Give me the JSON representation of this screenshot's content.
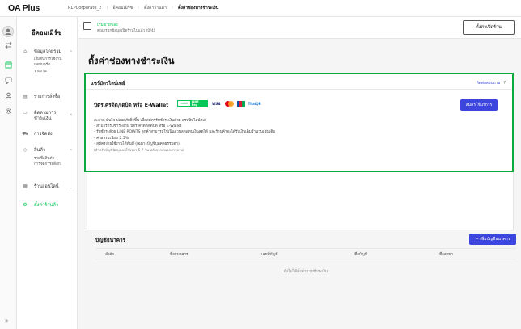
{
  "app": {
    "logo": "OA Plus"
  },
  "breadcrumb": [
    "RLPCorporate_2",
    "อีคอมเมิร์ซ",
    "ตั้งค่าร้านค้า",
    "ตั้งค่าช่องทางชำระเงิน"
  ],
  "sidebar": {
    "shop_name": "อีคอมเมิร์ซ",
    "items": [
      {
        "label": "ข้อมูลโดยรวม",
        "icon": "home-icon",
        "subitems": [
          "เริ่มต้นการใช้งาน",
          "แดชบอร์ด",
          "รายงาน"
        ]
      },
      {
        "label": "รายการสั่งซื้อ",
        "icon": "order-icon"
      },
      {
        "label": "ติดตามการชำระเงิน",
        "icon": "payment-icon"
      },
      {
        "label": "การจัดส่ง",
        "icon": "truck-icon"
      },
      {
        "label": "สินค้า",
        "icon": "tag-icon",
        "subitems": [
          "รายชื่อสินค้า",
          "การจัดการสต็อก"
        ]
      },
      {
        "label": "ร้านออนไลน์",
        "icon": "store-icon"
      },
      {
        "label": "ตั้งค่าร้านค้า",
        "icon": "settings-icon"
      }
    ]
  },
  "banner": {
    "title": "เริ่มขายของ",
    "subtitle": "คุณกรอกข้อมูลเปิดร้านไปแล้ว (0/4)",
    "button": "ตั้งค่าเปิดร้าน"
  },
  "page_title": "ตั้งค่าช่องทางชำระเงิน",
  "online_payment": {
    "section_title": "แชร์บัตรไลน์เพย์",
    "support_link": "ติดต่อสอบถาม",
    "method_name": "บัตรเครดิต/เดบิต หรือ E-Wallet",
    "logos": {
      "line_pay_a": "rabbit",
      "line_pay_b": "LINE Pay",
      "visa": "VISA",
      "thai": "ThaiQR"
    },
    "apply_button": "สมัครใช้บริการ",
    "description": [
      "สะดวก มั่นใจ ปลอดภัยยิ่งขึ้น เมื่อสมัครรับชำระเงินด้วย แรบบิทไลน์เพย์",
      "- สามารถรับชำระผ่าน บัตรเครดิต/เดบิต หรือ E-Wallet",
      "- รับชำระด้วย LINE POINTS ลูกค้าสามารถใช้เป็นส่วนลดแทนเงินสดได้ และร้านค้าจะได้รับเงินเต็มจำนวนเช่นเดิม",
      "- ค่าธรรมเนียม 2.5%",
      "- สมัครง่ายใช้งานได้ทันที (เฉพาะบัญชีบุคคลธรรมดา)",
      "(สำหรับบัญชีนิติบุคคลใช้เวลา 5-7 วัน หลังจากส่งเอกสารครบ)"
    ]
  },
  "bank_accounts": {
    "title": "บัญชีธนาคาร",
    "add_button": "+ เพิ่มบัญชีธนาคาร",
    "columns": [
      "ลำดับ",
      "ชื่อธนาคาร",
      "เลขที่บัญชี",
      "ชื่อบัญชี",
      "ชื่อสาขา"
    ],
    "empty_text": "ยังไม่ได้ตั้งค่าการชำระเงิน"
  },
  "colors": {
    "accent_green": "#06c755",
    "highlight_green": "#0aaa3c",
    "primary_blue": "#3c45de"
  }
}
